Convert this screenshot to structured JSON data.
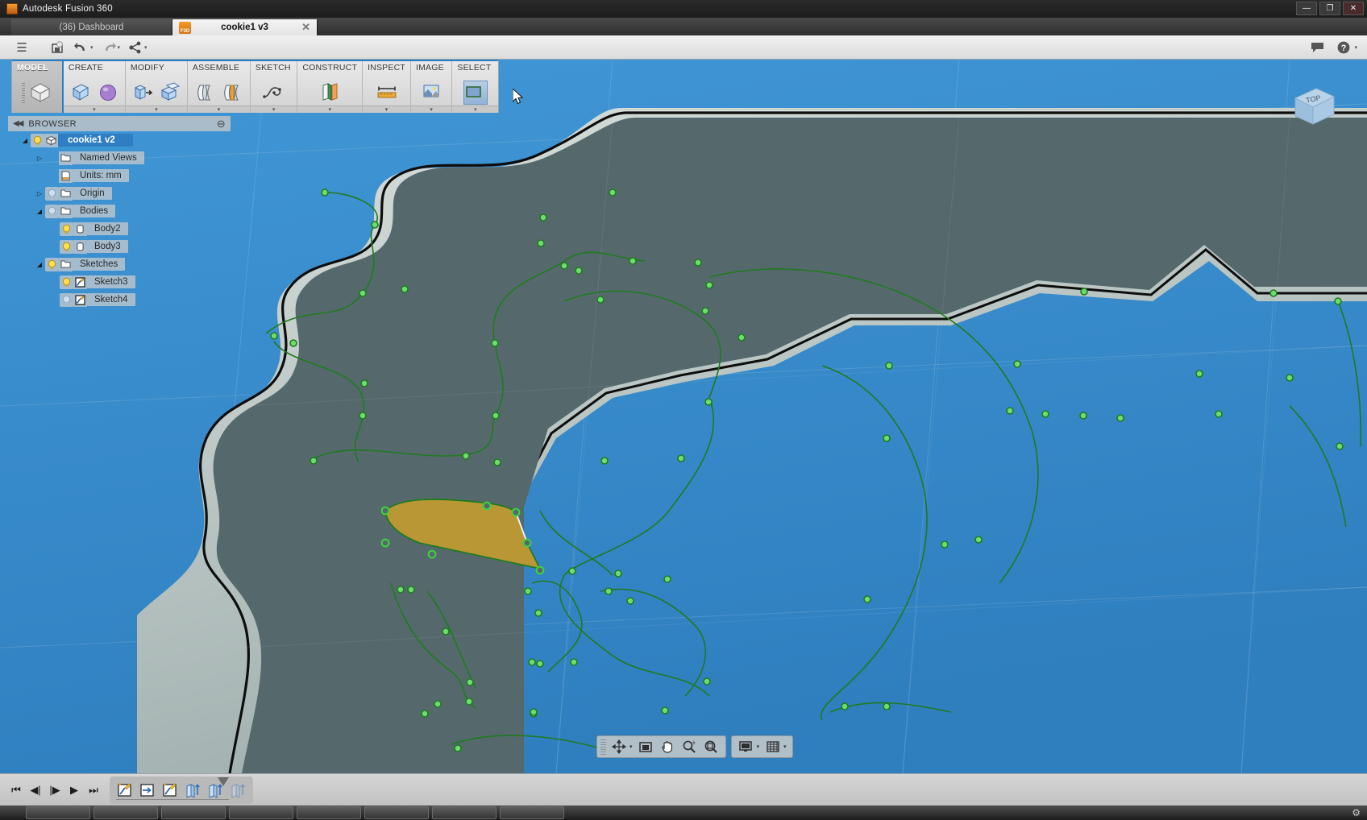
{
  "window": {
    "app_title": "Autodesk Fusion 360",
    "app_icon": "fusion-logo-icon",
    "minimize": "—",
    "maximize": "❐",
    "close": "✕"
  },
  "tabs": {
    "dashboard": "(36) Dashboard",
    "document": "cookie1 v3",
    "document_icon_label": "F3D",
    "close_glyph": "✕"
  },
  "quickbar": {
    "menu_icon": "☰",
    "save_icon": "💾",
    "undo_icon": "↩",
    "redo_icon": "↪",
    "share_icon": "⦿",
    "caret": "▾",
    "comment_icon": "🗨",
    "help_icon": "?",
    "help_caret": "▾"
  },
  "ribbon": {
    "panels": [
      {
        "label": "MODEL",
        "active": true,
        "buttons": [
          "model-cube-icon"
        ]
      },
      {
        "label": "CREATE",
        "active": false,
        "buttons": [
          "box-icon",
          "sphere-icon"
        ]
      },
      {
        "label": "MODIFY",
        "active": false,
        "buttons": [
          "press-pull-icon",
          "fillet-icon"
        ]
      },
      {
        "label": "ASSEMBLE",
        "active": false,
        "buttons": [
          "joint-icon",
          "as-built-joint-icon"
        ]
      },
      {
        "label": "SKETCH",
        "active": false,
        "buttons": [
          "spline-icon"
        ]
      },
      {
        "label": "CONSTRUCT",
        "active": false,
        "buttons": [
          "offset-plane-icon"
        ]
      },
      {
        "label": "INSPECT",
        "active": false,
        "buttons": [
          "measure-icon"
        ]
      },
      {
        "label": "IMAGE",
        "active": false,
        "buttons": [
          "canvas-image-icon"
        ]
      },
      {
        "label": "SELECT",
        "active": false,
        "buttons": [
          "select-window-icon"
        ]
      }
    ],
    "caret": "▾"
  },
  "browser": {
    "title": "BROWSER",
    "collapse_icon": "◀◀",
    "minus_icon": "⊖",
    "nodes": [
      {
        "label": "cookie1 v2",
        "indent": 0,
        "arrow": "expanded",
        "bulb": "on",
        "icon": "component-icon",
        "selected": true
      },
      {
        "label": "Named Views",
        "indent": 1,
        "arrow": "collapsed",
        "bulb": "none",
        "icon": "folder-icon",
        "selected": false
      },
      {
        "label": "Units: mm",
        "indent": 1,
        "arrow": "none",
        "bulb": "none",
        "icon": "units-icon",
        "selected": false
      },
      {
        "label": "Origin",
        "indent": 1,
        "arrow": "collapsed",
        "bulb": "off",
        "icon": "folder-icon",
        "selected": false
      },
      {
        "label": "Bodies",
        "indent": 1,
        "arrow": "expanded",
        "bulb": "off",
        "icon": "folder-icon",
        "selected": false
      },
      {
        "label": "Body2",
        "indent": 2,
        "arrow": "none",
        "bulb": "on",
        "icon": "body-icon",
        "selected": false
      },
      {
        "label": "Body3",
        "indent": 2,
        "arrow": "none",
        "bulb": "on",
        "icon": "body-icon",
        "selected": false
      },
      {
        "label": "Sketches",
        "indent": 1,
        "arrow": "expanded",
        "bulb": "on",
        "icon": "folder-icon",
        "selected": false
      },
      {
        "label": "Sketch3",
        "indent": 2,
        "arrow": "none",
        "bulb": "on",
        "icon": "sketch-icon",
        "selected": false
      },
      {
        "label": "Sketch4",
        "indent": 2,
        "arrow": "none",
        "bulb": "off",
        "icon": "sketch-icon",
        "selected": false
      }
    ]
  },
  "viewcube": {
    "face_label": "TOP"
  },
  "navbar": {
    "orbit_icon": "orbit-icon",
    "orbit_caret": "▾",
    "look_at_icon": "look-at-icon",
    "pan_icon": "pan-hand-icon",
    "zoom_icon": "zoom-icon",
    "fit_icon": "fit-icon",
    "display_icon": "display-settings-icon",
    "display_caret": "▾",
    "grid_icon": "grid-snap-icon",
    "grid_caret": "▾"
  },
  "timeline": {
    "controls": [
      "⏮",
      "◀|",
      "|▶",
      "▶",
      "⏭"
    ],
    "features": [
      {
        "icon": "sketch-create-icon",
        "ghost": false
      },
      {
        "icon": "sketch-offset-icon",
        "ghost": false
      },
      {
        "icon": "sketch-create-icon",
        "ghost": false
      },
      {
        "icon": "extrude-icon",
        "ghost": false
      },
      {
        "icon": "extrude-icon",
        "ghost": false
      },
      {
        "icon": "extrude-icon",
        "ghost": true
      }
    ]
  },
  "canvas": {
    "background_color": "#3c8ecd",
    "body_surface_color": "#55696d",
    "body_edge_color": "#c5cfcd",
    "sketch_curve_color": "#1f7a1f",
    "selected_profile_color": "#b89734",
    "vertex_color": "#6fdc6f"
  },
  "taskbar": {
    "settings_icon": "⚙"
  }
}
